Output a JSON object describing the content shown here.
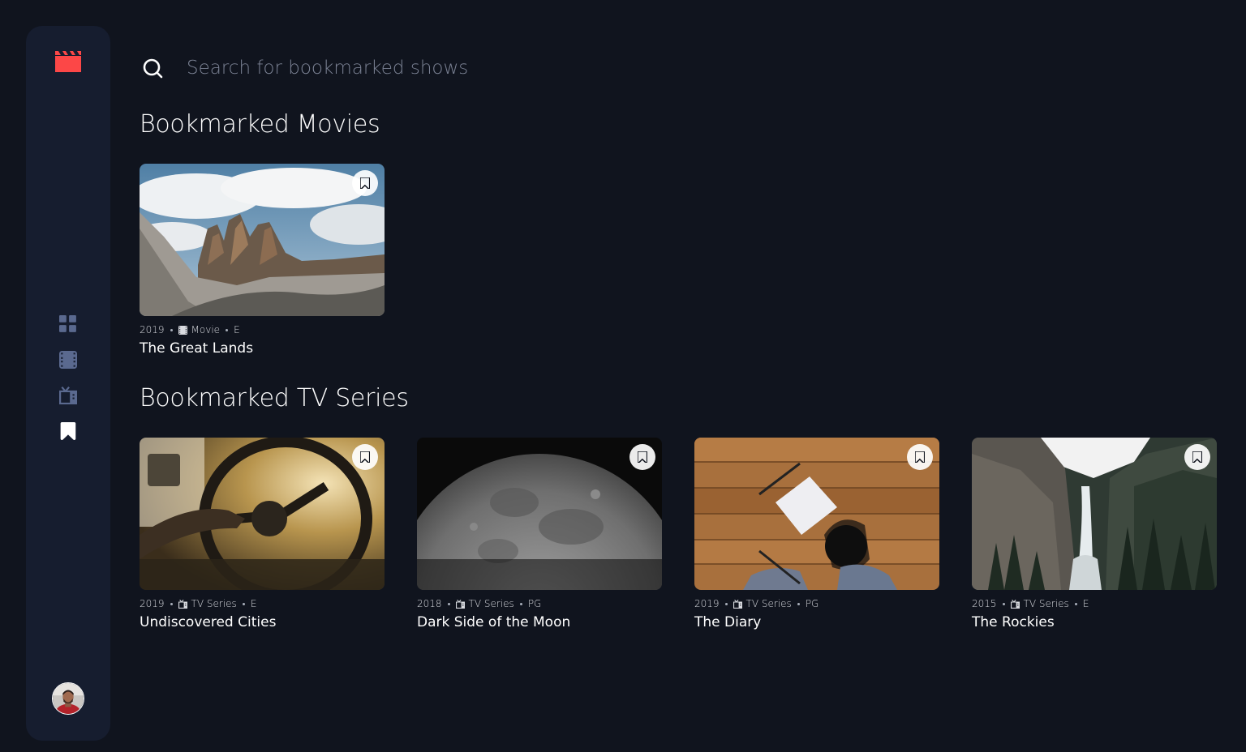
{
  "sidebar": {
    "logo_icon": "film-clapper-icon",
    "accent_color": "#fc4747",
    "nav": [
      {
        "name": "home",
        "icon": "grid-icon",
        "active": false
      },
      {
        "name": "movies",
        "icon": "film-icon",
        "active": false
      },
      {
        "name": "tv-series",
        "icon": "tv-icon",
        "active": false
      },
      {
        "name": "bookmarks",
        "icon": "bookmark-icon",
        "active": true
      }
    ],
    "avatar_icon": "user-avatar"
  },
  "search": {
    "placeholder": "Search for bookmarked shows",
    "value": ""
  },
  "sections": {
    "movies_title": "Bookmarked Movies",
    "tv_title": "Bookmarked TV Series"
  },
  "movies": [
    {
      "year": "2019",
      "category": "Movie",
      "rating": "E",
      "title": "The Great Lands",
      "image": "mountain-peaks-photo",
      "bookmarked": true
    }
  ],
  "tv_series": [
    {
      "year": "2019",
      "category": "TV Series",
      "rating": "E",
      "title": "Undiscovered Cities",
      "image": "car-steering-wheel-photo",
      "bookmarked": true
    },
    {
      "year": "2018",
      "category": "TV Series",
      "rating": "PG",
      "title": "Dark Side of the Moon",
      "image": "half-moon-photo",
      "bookmarked": true
    },
    {
      "year": "2019",
      "category": "TV Series",
      "rating": "PG",
      "title": "The Diary",
      "image": "wooden-desk-notepad-photo",
      "bookmarked": true
    },
    {
      "year": "2015",
      "category": "TV Series",
      "rating": "E",
      "title": "The Rockies",
      "image": "waterfall-canyon-photo",
      "bookmarked": true
    }
  ],
  "colors": {
    "background": "#10141e",
    "sidebar": "#161d2f",
    "nav_inactive": "#5a698f",
    "nav_active": "#ffffff",
    "placeholder": "#7b8294"
  }
}
